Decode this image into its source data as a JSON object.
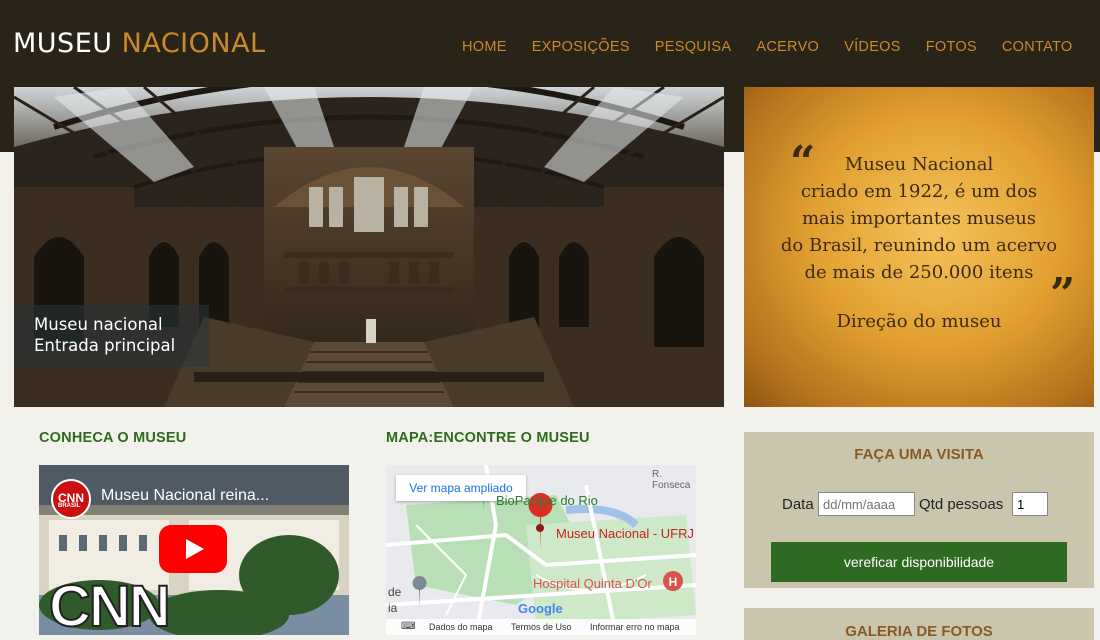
{
  "brand": {
    "word1": "MUSEU",
    "word2": "NACIONAL"
  },
  "nav": {
    "items": [
      "HOME",
      "EXPOSIÇÕES",
      "PESQUISA",
      "ACERVO",
      "VÍDEOS",
      "FOTOS",
      "CONTATO"
    ]
  },
  "hero": {
    "caption_line1": "Museu nacional",
    "caption_line2": "Entrada principal"
  },
  "quote": {
    "lines": [
      "Museu Nacional",
      "criado em 1922, é um dos",
      "mais importantes museus",
      "do Brasil, reunindo um acervo",
      "de mais de 250.000 itens"
    ],
    "open_mark": "“",
    "close_mark": "”",
    "signature": "Direção do museu"
  },
  "sections": {
    "about": "CONHECA O MUSEU",
    "map": "MAPA:ENCONTRE O MUSEU"
  },
  "video": {
    "title": "Museu Nacional reina...",
    "channel_badge": "CNN",
    "channel_sub": "BRASIL",
    "logo_text": "CNN",
    "menu": "⋮"
  },
  "map": {
    "button": "Ver mapa ampliado",
    "labels": {
      "park": "BioParque do Rio",
      "museum": "Museu Nacional - UFRJ",
      "hospital": "Hospital Quinta D'Or",
      "street": "R. Fonseca",
      "side1": "de",
      "side2": "ia",
      "google": "Google"
    },
    "footer": {
      "data": "Dados do mapa",
      "terms": "Termos de Uso",
      "report": "Informar erro no mapa"
    }
  },
  "visit": {
    "title": "FAÇA UMA VISITA",
    "date_label": "Data",
    "date_placeholder": "dd/mm/aaaa",
    "qty_label": "Qtd pessoas",
    "qty_value": "1",
    "button": "vereficar disponibilidade"
  },
  "gallery": {
    "title": "GALERIA DE FOTOS"
  },
  "colors": {
    "header_bg": "#2a2418",
    "accent": "#c98a2b",
    "green": "#2f6a1d",
    "panel": "#cac6ae",
    "panel_title": "#8b5a22"
  }
}
